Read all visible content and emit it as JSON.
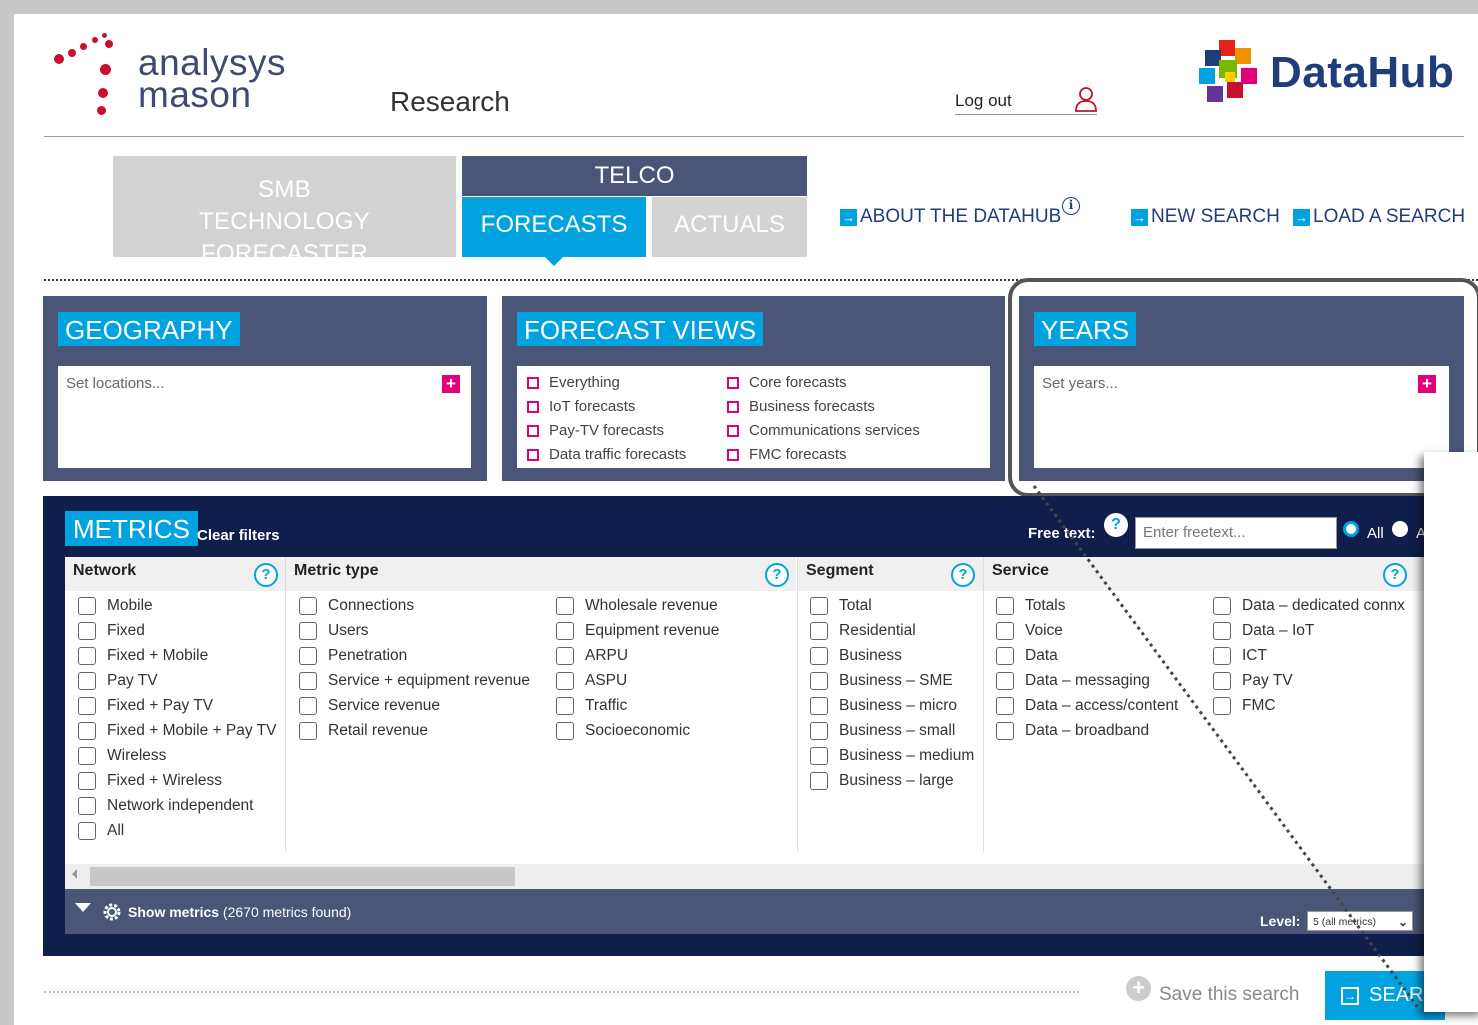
{
  "header": {
    "logo_line1": "analysys",
    "logo_line2": "mason",
    "section": "Research",
    "logout": "Log out",
    "product": "DataHub"
  },
  "tabs": {
    "smb_line1": "SMB",
    "smb_line2": "TECHNOLOGY FORECASTER",
    "telco": "TELCO",
    "forecasts": "FORECASTS",
    "actuals": "ACTUALS"
  },
  "nav": {
    "about": "ABOUT THE DATAHUB",
    "new_search": "NEW SEARCH",
    "load_search": "LOAD A SEARCH"
  },
  "geography": {
    "title": "GEOGRAPHY",
    "placeholder": "Set locations..."
  },
  "forecast_views": {
    "title": "FORECAST VIEWS",
    "items": [
      "Everything",
      "IoT forecasts",
      "Pay-TV forecasts",
      "Data traffic forecasts",
      "Core forecasts",
      "Business forecasts",
      "Communications services",
      "FMC forecasts"
    ]
  },
  "years": {
    "title": "YEARS",
    "placeholder": "Set years..."
  },
  "metrics": {
    "title": "METRICS",
    "clear": "Clear filters",
    "free_text_label": "Free text:",
    "free_text_placeholder": "Enter freetext...",
    "radio_all": "All",
    "radio_any": "A",
    "columns": {
      "network": {
        "title": "Network",
        "items": [
          "Mobile",
          "Fixed",
          "Fixed + Mobile",
          "Pay TV",
          "Fixed + Pay TV",
          "Fixed + Mobile + Pay TV",
          "Wireless",
          "Fixed + Wireless",
          "Network independent",
          "All"
        ]
      },
      "metric_type": {
        "title": "Metric type",
        "items": [
          "Connections",
          "Users",
          "Penetration",
          "Service + equipment revenue",
          "Service revenue",
          "Retail revenue",
          "Wholesale revenue",
          "Equipment revenue",
          "ARPU",
          "ASPU",
          "Traffic",
          "Socioeconomic"
        ]
      },
      "segment": {
        "title": "Segment",
        "items": [
          "Total",
          "Residential",
          "Business",
          "Business – SME",
          "Business – micro",
          "Business – small",
          "Business – medium",
          "Business – large"
        ]
      },
      "service": {
        "title": "Service",
        "items": [
          "Totals",
          "Voice",
          "Data",
          "Data – messaging",
          "Data – access/content",
          "Data – broadband",
          "Data – dedicated connx",
          "Data – IoT",
          "ICT",
          "Pay TV",
          "FMC"
        ]
      }
    },
    "show_label": "Show metrics",
    "found": "(2670 metrics found)",
    "level_label": "Level:",
    "level_value": "5 (all metrics)"
  },
  "footer": {
    "save": "Save this search",
    "search": "SEAR"
  },
  "colors": {
    "navy": "#0f1e4a",
    "slate": "#4a5577",
    "cyan": "#00a3e0",
    "magenta": "#e0007a"
  }
}
